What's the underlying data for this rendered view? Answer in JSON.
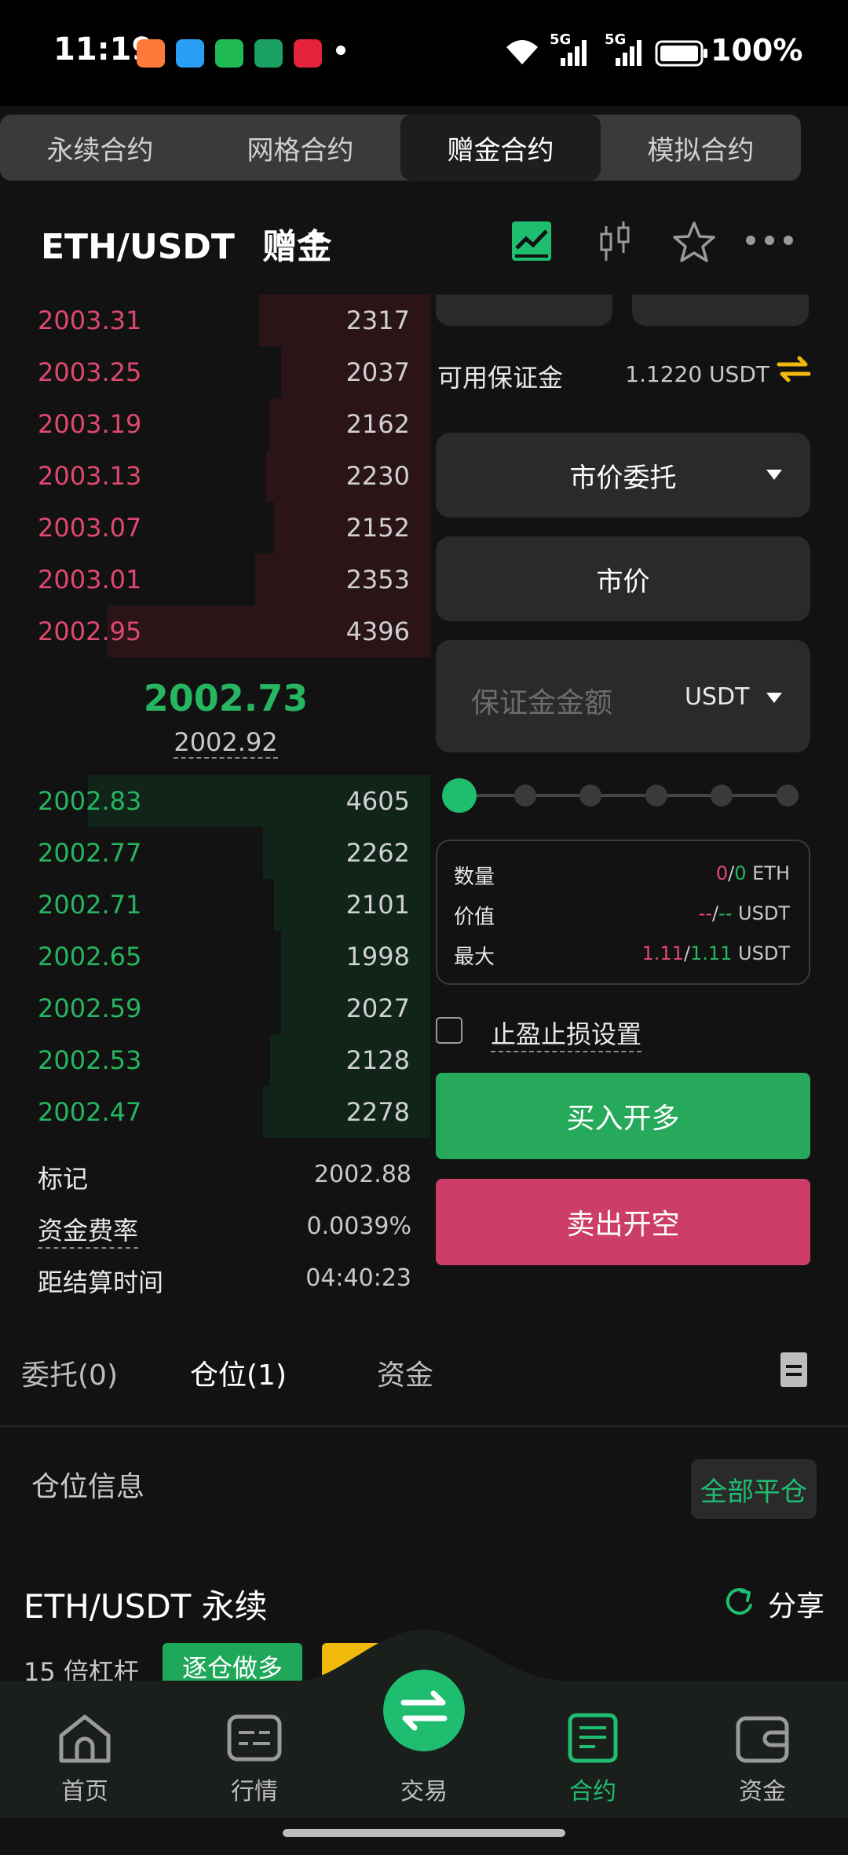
{
  "status_bar": {
    "time": "11:19",
    "battery": "100%",
    "signal1": "5G",
    "signal2": "5G"
  },
  "segment_tabs": [
    {
      "label": "永续合约",
      "active": false
    },
    {
      "label": "网格合约",
      "active": false
    },
    {
      "label": "赠金合约",
      "active": true
    },
    {
      "label": "模拟合约",
      "active": false
    }
  ],
  "header": {
    "pair": "ETH/USDT",
    "tag": "赠金"
  },
  "order_book": {
    "asks": [
      {
        "price": "2003.31",
        "qty": "2317",
        "depth": 0.46
      },
      {
        "price": "2003.25",
        "qty": "2037",
        "depth": 0.4
      },
      {
        "price": "2003.19",
        "qty": "2162",
        "depth": 0.43
      },
      {
        "price": "2003.13",
        "qty": "2230",
        "depth": 0.44
      },
      {
        "price": "2003.07",
        "qty": "2152",
        "depth": 0.42
      },
      {
        "price": "2003.01",
        "qty": "2353",
        "depth": 0.47
      },
      {
        "price": "2002.95",
        "qty": "4396",
        "depth": 0.87
      }
    ],
    "last_price": "2002.73",
    "index_price": "2002.92",
    "bids": [
      {
        "price": "2002.83",
        "qty": "4605",
        "depth": 0.92
      },
      {
        "price": "2002.77",
        "qty": "2262",
        "depth": 0.45
      },
      {
        "price": "2002.71",
        "qty": "2101",
        "depth": 0.42
      },
      {
        "price": "2002.65",
        "qty": "1998",
        "depth": 0.4
      },
      {
        "price": "2002.59",
        "qty": "2027",
        "depth": 0.4
      },
      {
        "price": "2002.53",
        "qty": "2128",
        "depth": 0.43
      },
      {
        "price": "2002.47",
        "qty": "2278",
        "depth": 0.45
      }
    ],
    "mark_label": "标记",
    "mark_value": "2002.88",
    "funding_label": "资金费率",
    "funding_value": "0.0039%",
    "settle_label": "距结算时间",
    "settle_value": "04:40:23"
  },
  "order_panel": {
    "margin_label": "可用保证金",
    "margin_value": "1.1220 USDT",
    "order_type": "市价委托",
    "price_field": "市价",
    "amount_placeholder": "保证金金额",
    "amount_unit": "USDT",
    "slider_level": 0,
    "qty_label": "数量",
    "qty_a": "0",
    "qty_b": "0",
    "qty_unit": "ETH",
    "value_label": "价值",
    "value_a": "--",
    "value_b": "--",
    "value_unit": "USDT",
    "max_label": "最大",
    "max_a": "1.11",
    "max_b": "1.11",
    "max_unit": "USDT",
    "tpsl_label": "止盈止损设置",
    "buy_label": "买入开多",
    "sell_label": "卖出开空"
  },
  "bottom_tabs": [
    {
      "label": "委托(0)",
      "active": false
    },
    {
      "label": "仓位(1)",
      "active": true
    },
    {
      "label": "资金",
      "active": false
    }
  ],
  "positions": {
    "section_title": "仓位信息",
    "close_all": "全部平仓",
    "pair_title": "ETH/USDT 永续",
    "share": "分享",
    "leverage": "15 倍杠杆",
    "mode_badge": "逐仓做多"
  },
  "nav": [
    {
      "label": "首页",
      "icon": "home-icon",
      "active": false
    },
    {
      "label": "行情",
      "icon": "market-icon",
      "active": false
    },
    {
      "label": "交易",
      "icon": "swap-icon",
      "active": false
    },
    {
      "label": "合约",
      "icon": "contract-icon",
      "active": true
    },
    {
      "label": "资金",
      "icon": "wallet-icon",
      "active": false
    }
  ],
  "colors": {
    "green": "#1fbd70",
    "red": "#e0486f",
    "accent": "#f0b90b"
  }
}
